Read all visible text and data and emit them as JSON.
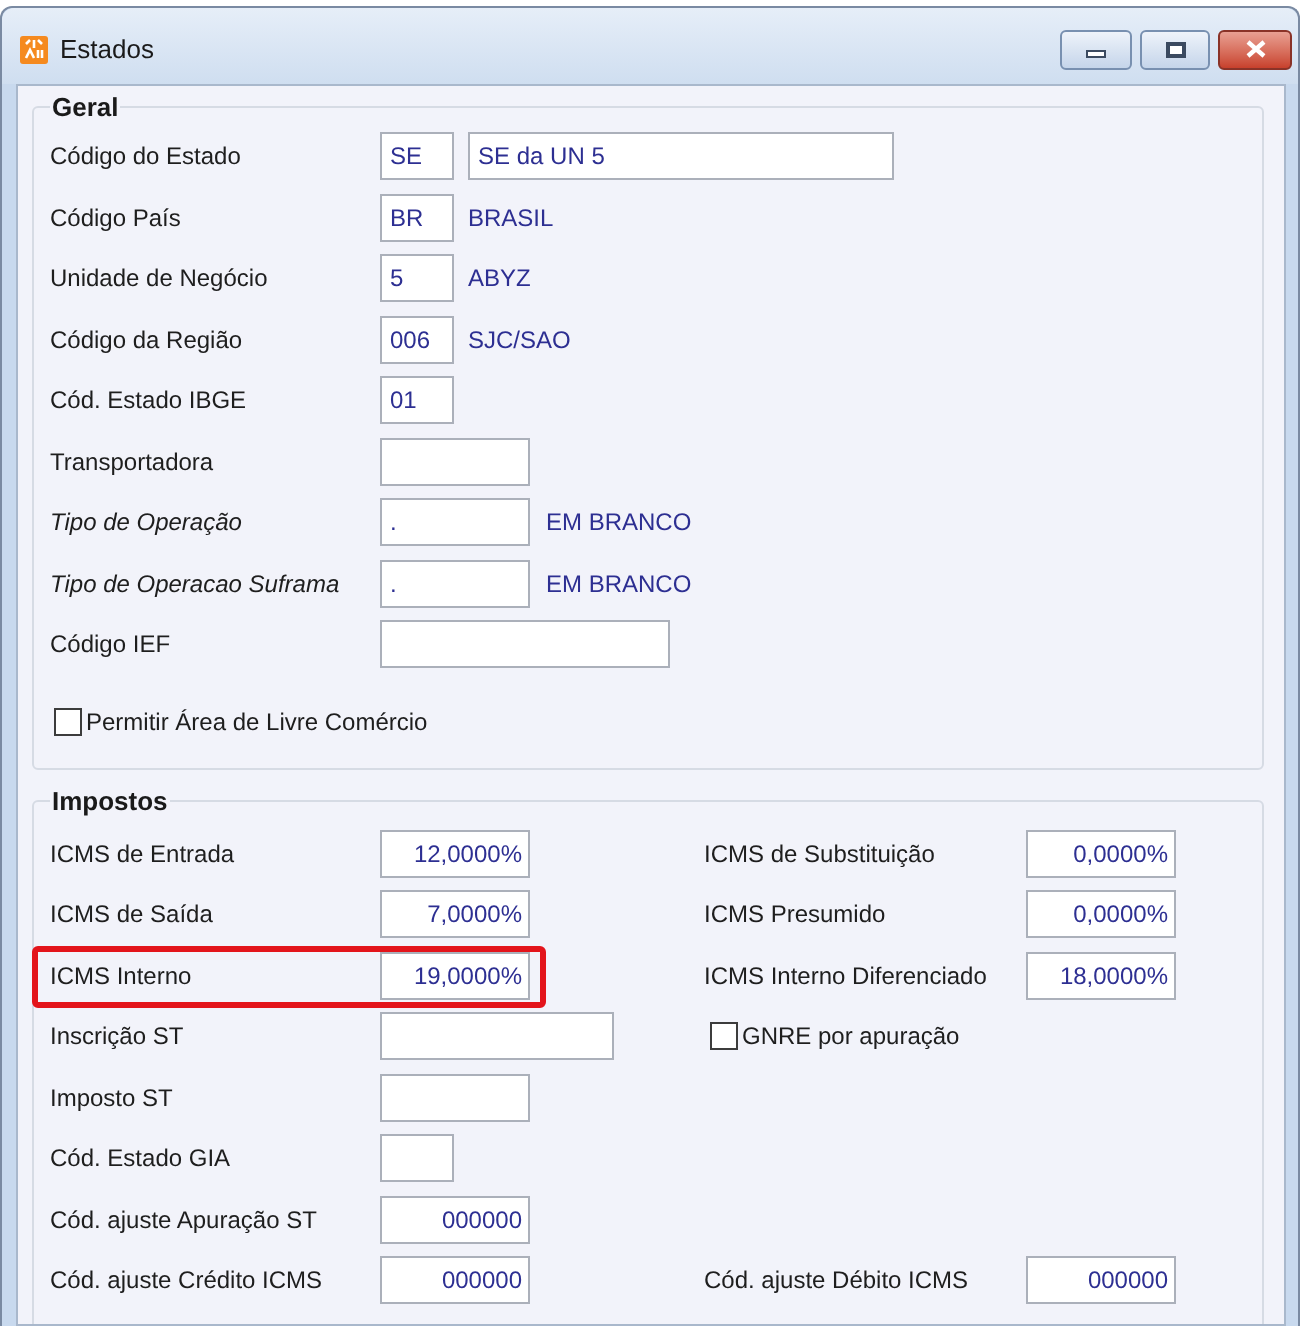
{
  "window": {
    "title": "Estados"
  },
  "geral": {
    "title": "Geral",
    "rows": [
      {
        "label": "Código do Estado",
        "lookup": false,
        "value": "SE",
        "description_field": "SE da UN 5"
      },
      {
        "label": "Código País",
        "lookup": false,
        "value": "BR",
        "description": "BRASIL"
      },
      {
        "label": "Unidade de Negócio",
        "lookup": false,
        "value": "5",
        "description": "ABYZ"
      },
      {
        "label": "Código da Região",
        "lookup": false,
        "value": "006",
        "description": "SJC/SAO"
      },
      {
        "label": "Cód. Estado IBGE",
        "lookup": false,
        "value": "01"
      },
      {
        "label": "Transportadora",
        "lookup": false
      },
      {
        "label": "Tipo de Operação",
        "lookup": true,
        "value": ".",
        "description": "EM BRANCO"
      },
      {
        "label": "Tipo de Operacao Suframa",
        "lookup": true,
        "value": ".",
        "description": "EM BRANCO"
      },
      {
        "label": "Código IEF",
        "lookup": false
      }
    ],
    "checkbox": {
      "label": "Permitir Área de Livre Comércio",
      "checked": false
    }
  },
  "impostos": {
    "title": "Impostos",
    "left": [
      {
        "label": "ICMS de Entrada",
        "value": "12,0000%",
        "highlighted": false
      },
      {
        "label": "ICMS de Saída",
        "value": "7,0000%",
        "highlighted": false
      },
      {
        "label": "ICMS Interno",
        "value": "19,0000%",
        "highlighted": true
      },
      {
        "label": "Inscrição ST",
        "highlighted": false
      },
      {
        "label": "Imposto ST",
        "highlighted": false
      },
      {
        "label": "Cód. Estado GIA",
        "highlighted": false
      },
      {
        "label": "Cód. ajuste Apuração ST",
        "value": "000000",
        "highlighted": false
      },
      {
        "label": "Cód. ajuste Crédito ICMS",
        "value": "000000",
        "highlighted": false
      }
    ],
    "right": [
      {
        "kind": "field",
        "label": "ICMS de Substituição",
        "value": "0,0000%"
      },
      {
        "kind": "field",
        "label": "ICMS Presumido",
        "value": "0,0000%"
      },
      {
        "kind": "field",
        "label": "ICMS Interno Diferenciado",
        "value": "18,0000%"
      },
      {
        "kind": "checkbox",
        "label": "GNRE por apuração",
        "checked": false
      },
      {
        "kind": "field",
        "label": "Cód. ajuste Débito ICMS",
        "value": "000000"
      }
    ]
  }
}
